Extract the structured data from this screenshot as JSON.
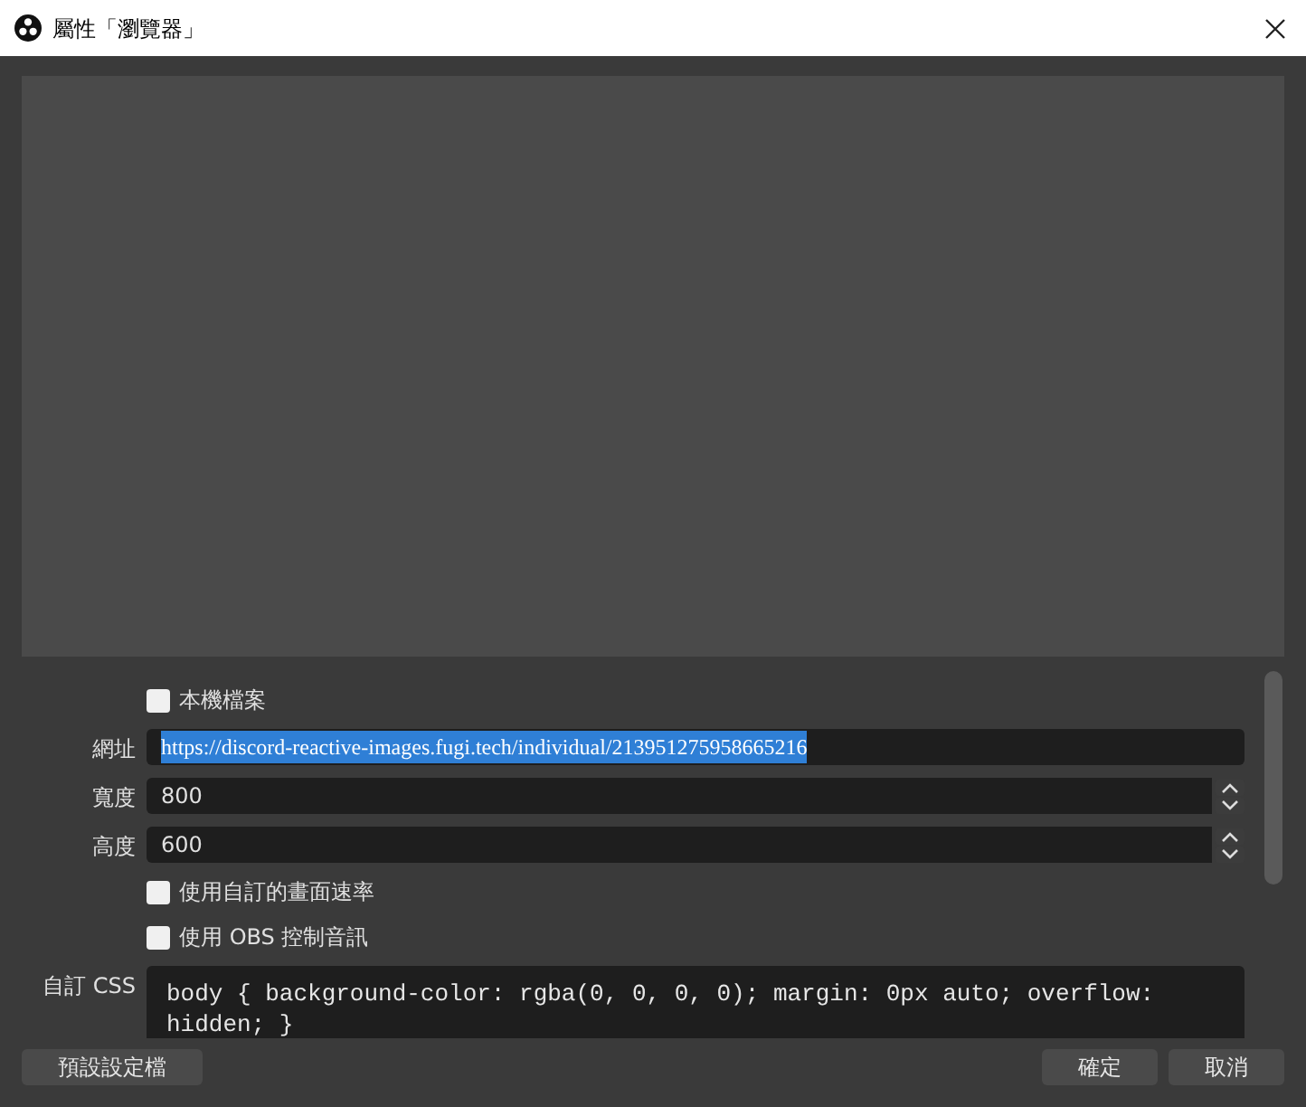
{
  "window": {
    "title": "屬性「瀏覽器」"
  },
  "fields": [
    {
      "kind": "checkbox",
      "label": "本機檔案",
      "checked": false
    },
    {
      "kind": "text",
      "label": "網址",
      "value": "https://discord-reactive-images.fugi.tech/individual/213951275958665216",
      "selected": true
    },
    {
      "kind": "spin",
      "label": "寬度",
      "value": "800"
    },
    {
      "kind": "spin",
      "label": "高度",
      "value": "600"
    },
    {
      "kind": "checkbox",
      "label": "使用自訂的畫面速率",
      "checked": false
    },
    {
      "kind": "checkbox",
      "label": "使用 OBS 控制音訊",
      "checked": false
    },
    {
      "kind": "code",
      "label": "自訂 CSS",
      "value": "body { background-color: rgba(0, 0, 0, 0); margin: 0px auto; overflow: hidden; }"
    }
  ],
  "buttons": {
    "defaults": "預設設定檔",
    "ok": "確定",
    "cancel": "取消"
  }
}
